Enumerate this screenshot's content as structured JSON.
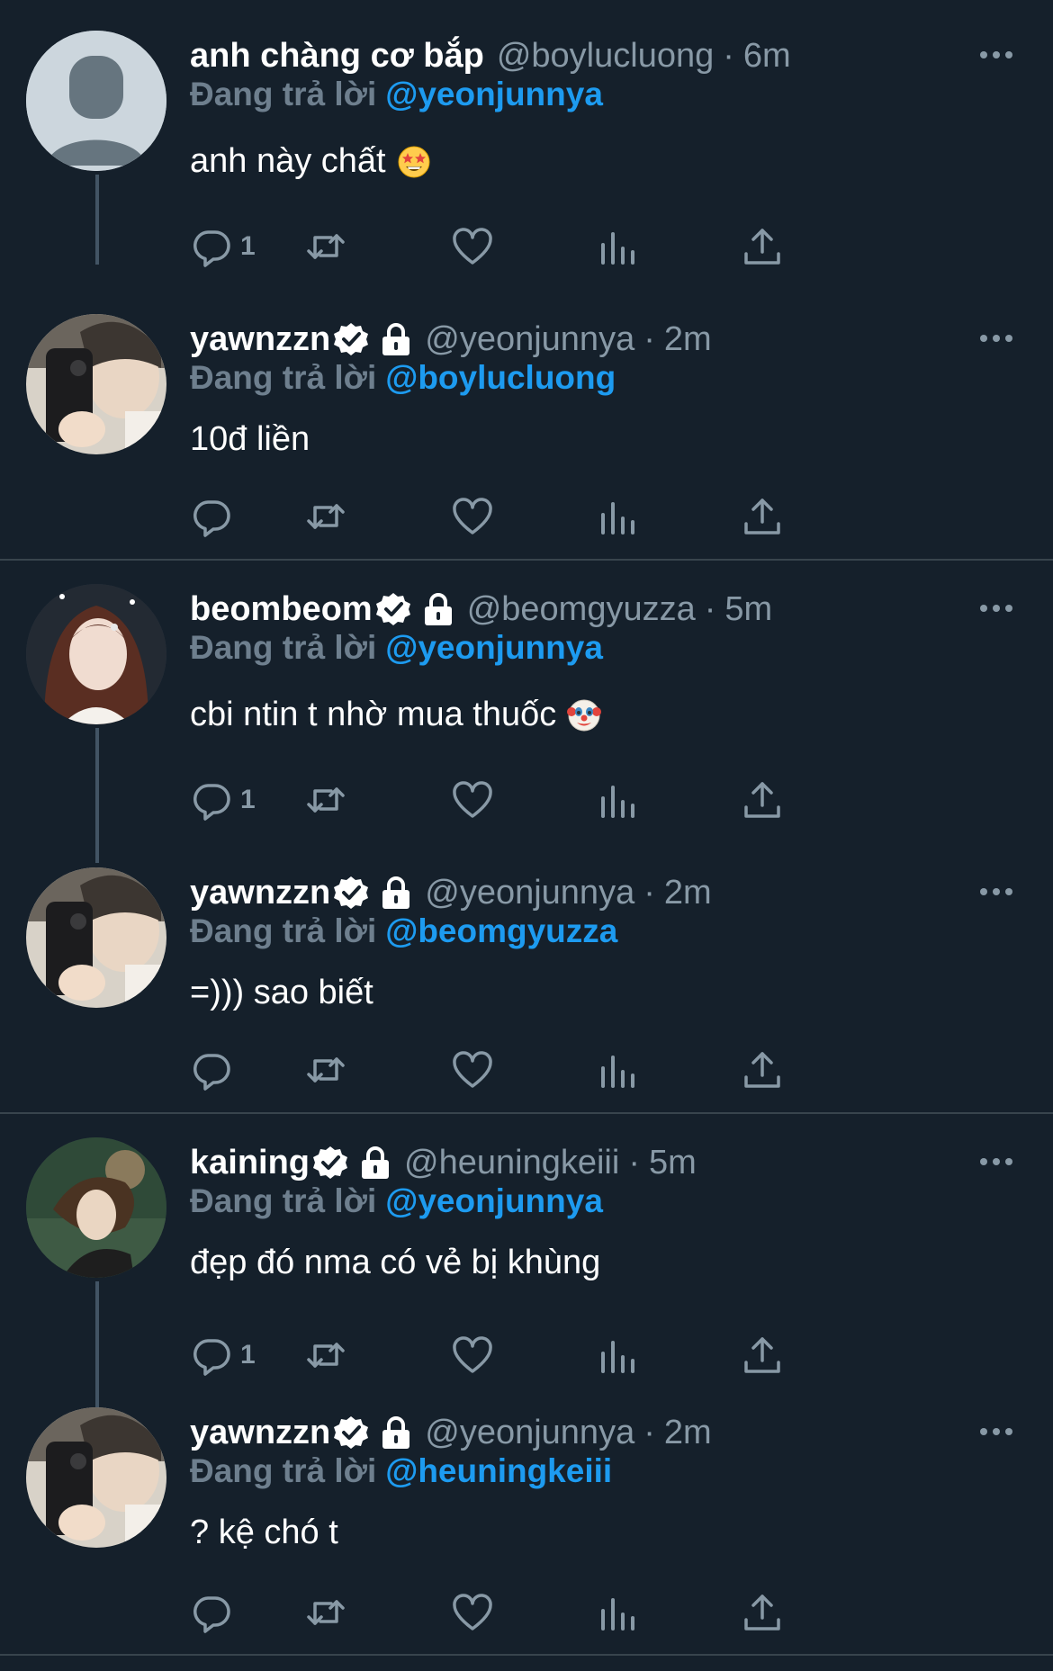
{
  "reply_label": "Đang trả lời",
  "tweets": [
    {
      "name": "anh chàng cơ bắp",
      "handle": "@boylucluong",
      "time": "6m",
      "reply_to": "@yeonjunnya",
      "text": "anh này chất",
      "emoji": "star-struck",
      "reply_count": "1",
      "verified": false,
      "protected": false
    },
    {
      "name": "yawnzzn",
      "handle": "@yeonjunnya",
      "time": "2m",
      "reply_to": "@boylucluong",
      "text": "10đ liền",
      "reply_count": "",
      "verified": true,
      "protected": true
    },
    {
      "name": "beombeom",
      "handle": "@beomgyuzza",
      "time": "5m",
      "reply_to": "@yeonjunnya",
      "text": "cbi ntin t nhờ mua thuốc",
      "emoji": "clown-face",
      "reply_count": "1",
      "verified": true,
      "protected": true
    },
    {
      "name": "yawnzzn",
      "handle": "@yeonjunnya",
      "time": "2m",
      "reply_to": "@beomgyuzza",
      "text": "=))) sao biết",
      "reply_count": "",
      "verified": true,
      "protected": true
    },
    {
      "name": "kaining",
      "handle": "@heuningkeiii",
      "time": "5m",
      "reply_to": "@yeonjunnya",
      "text": "đẹp đó nma có vẻ bị khùng",
      "reply_count": "1",
      "verified": true,
      "protected": true
    },
    {
      "name": "yawnzzn",
      "handle": "@yeonjunnya",
      "time": "2m",
      "reply_to": "@heuningkeiii",
      "text": "? kệ chó t",
      "reply_count": "",
      "verified": true,
      "protected": true
    }
  ],
  "colors": {
    "background": "#15202b",
    "accent": "#1d9bf0",
    "muted": "#8899a6",
    "divider": "#38444d"
  }
}
